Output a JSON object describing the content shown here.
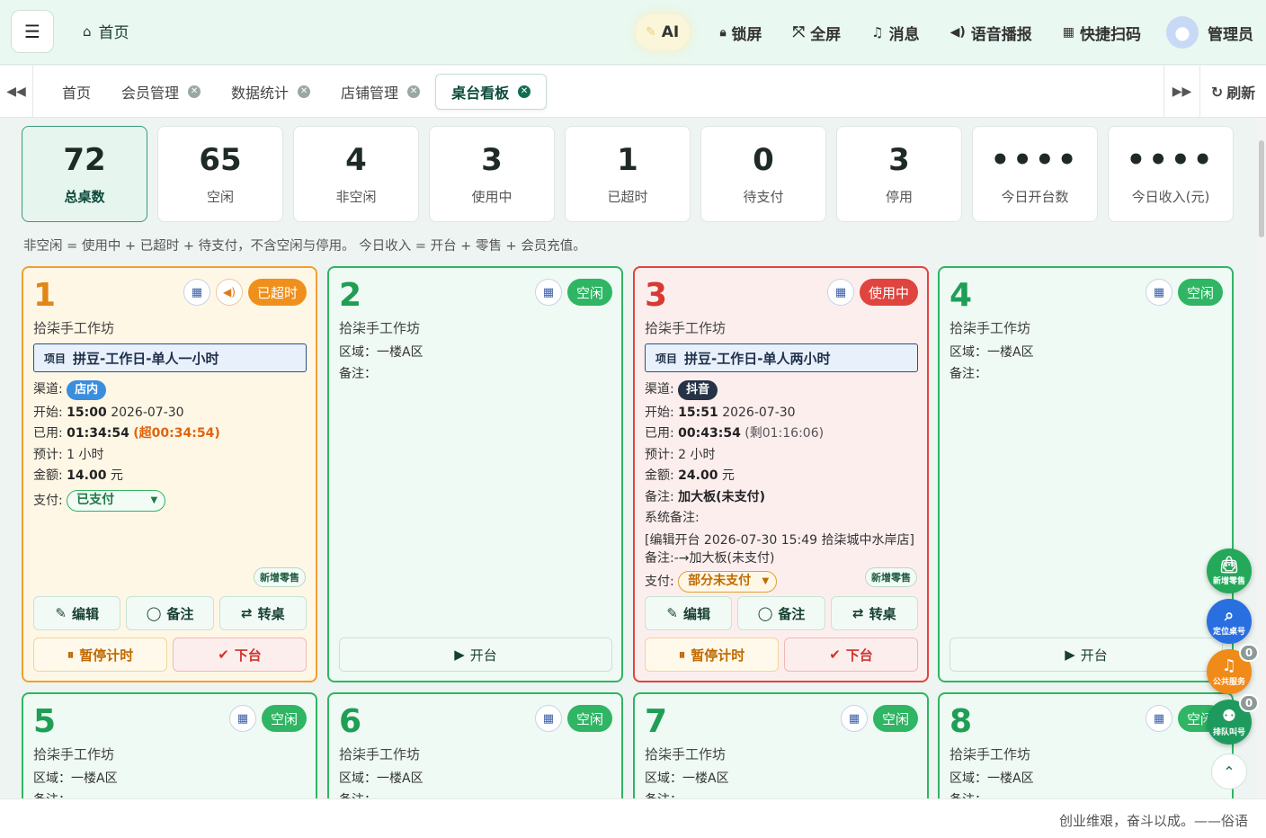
{
  "header": {
    "home": "首页",
    "ai": "AI",
    "lock": "锁屏",
    "fullscreen": "全屏",
    "messages": "消息",
    "voice": "语音播报",
    "scan": "快捷扫码",
    "user": "管理员"
  },
  "tabs": [
    {
      "label": "首页"
    },
    {
      "label": "会员管理"
    },
    {
      "label": "数据统计"
    },
    {
      "label": "店铺管理"
    },
    {
      "label": "桌台看板"
    }
  ],
  "refresh": "刷新",
  "stats": [
    {
      "value": "72",
      "label": "总桌数"
    },
    {
      "value": "65",
      "label": "空闲"
    },
    {
      "value": "4",
      "label": "非空闲"
    },
    {
      "value": "3",
      "label": "使用中"
    },
    {
      "value": "1",
      "label": "已超时"
    },
    {
      "value": "0",
      "label": "待支付"
    },
    {
      "value": "3",
      "label": "停用"
    },
    {
      "value": "••••",
      "label": "今日开台数"
    },
    {
      "value": "••••",
      "label": "今日收入(元)"
    }
  ],
  "formula": "非空闲 = 使用中 + 已超时 + 待支付，不含空闲与停用。 今日收入 = 开台 + 零售 + 会员充值。",
  "labels": {
    "project": "项目",
    "channel": "渠道:",
    "start": "开始:",
    "used": "已用:",
    "estimate": "预计:",
    "amount": "金额:",
    "pay": "支付:",
    "area": "区域：",
    "remark_label": "备注：",
    "remark": "备注:",
    "sys_remark": "系统备注:",
    "new_retail": "新增零售",
    "edit": "编辑",
    "note": "备注",
    "transfer": "转桌",
    "pause": "暂停计时",
    "offline": "下台",
    "open": "开台",
    "yuan": "元"
  },
  "tables": [
    {
      "no": "1",
      "status": "已超时",
      "shop": "拾柒手工作坊",
      "project": "拼豆-工作日-单人一小时",
      "channel": "店内",
      "start_time": "15:00",
      "start_date": "2026-07-30",
      "used": "01:34:54",
      "used_extra": "(超00:34:54)",
      "estimate": "1 小时",
      "amount": "14.00",
      "payment": "已支付"
    },
    {
      "no": "2",
      "status": "空闲",
      "shop": "拾柒手工作坊",
      "area": "一楼A区"
    },
    {
      "no": "3",
      "status": "使用中",
      "shop": "拾柒手工作坊",
      "project": "拼豆-工作日-单人两小时",
      "channel": "抖音",
      "start_time": "15:51",
      "start_date": "2026-07-30",
      "used": "00:43:54",
      "used_extra": "(剩01:16:06)",
      "estimate": "2 小时",
      "amount": "24.00",
      "remark": "加大板(未支付)",
      "sys_remark": "[编辑开台 2026-07-30 15:49 拾柒城中水岸店] 备注:-→加大板(未支付)",
      "payment": "部分未支付"
    },
    {
      "no": "4",
      "status": "空闲",
      "shop": "拾柒手工作坊",
      "area": "一楼A区"
    },
    {
      "no": "5",
      "status": "空闲",
      "shop": "拾柒手工作坊",
      "area": "一楼A区"
    },
    {
      "no": "6",
      "status": "空闲",
      "shop": "拾柒手工作坊",
      "area": "一楼A区"
    },
    {
      "no": "7",
      "status": "空闲",
      "shop": "拾柒手工作坊",
      "area": "一楼A区"
    },
    {
      "no": "8",
      "status": "空闲",
      "shop": "拾柒手工作坊",
      "area": "一楼A区"
    }
  ],
  "floats": {
    "retail": "新增零售",
    "locate": "定位桌号",
    "service": "公共服务",
    "queue": "排队叫号",
    "service_count": "0",
    "queue_count": "0"
  },
  "footer": "创业维艰，奋斗以成。——俗语",
  "colors": {
    "primary": "#0f6e52",
    "free": "#2fb563",
    "overtime": "#f0901c",
    "in_use": "#e0443e"
  }
}
